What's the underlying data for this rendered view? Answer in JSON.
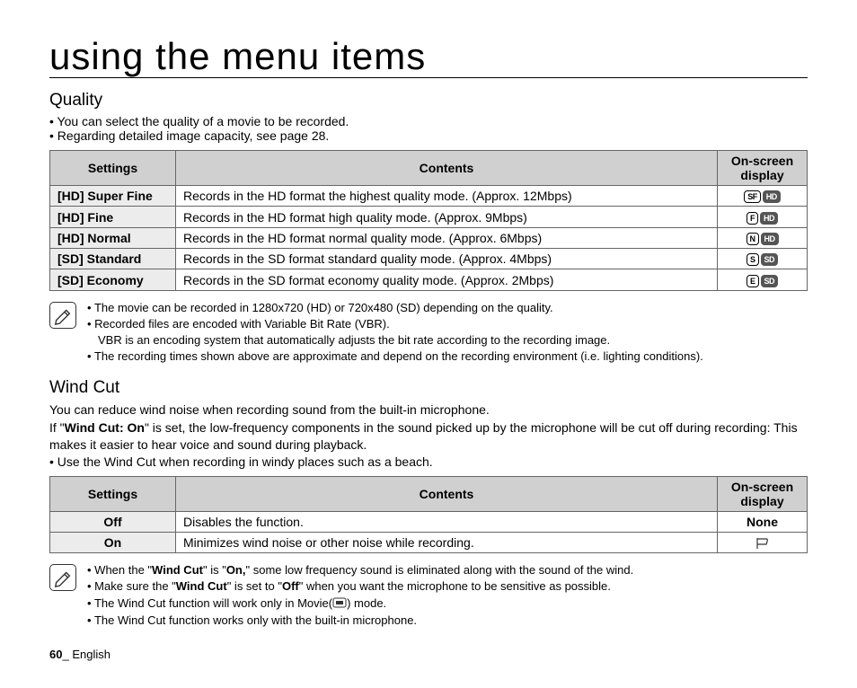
{
  "title": "using the menu items",
  "quality": {
    "heading": "Quality",
    "intro": [
      "You can select the quality of a movie to be recorded.",
      "Regarding detailed image capacity, see page 28."
    ],
    "headers": [
      "Settings",
      "Contents",
      "On-screen display"
    ],
    "rows": [
      {
        "setting": "[HD] Super Fine",
        "content": "Records in the HD format the highest quality mode. (Approx. 12Mbps)",
        "icon1": "SF",
        "icon2": "HD"
      },
      {
        "setting": "[HD] Fine",
        "content": "Records in the HD format high quality mode. (Approx. 9Mbps)",
        "icon1": "F",
        "icon2": "HD"
      },
      {
        "setting": "[HD] Normal",
        "content": "Records in the HD format normal quality mode. (Approx. 6Mbps)",
        "icon1": "N",
        "icon2": "HD"
      },
      {
        "setting": "[SD] Standard",
        "content": "Records in the SD format standard quality mode. (Approx. 4Mbps)",
        "icon1": "S",
        "icon2": "SD"
      },
      {
        "setting": "[SD] Economy",
        "content": "Records in the SD format economy quality mode. (Approx. 2Mbps)",
        "icon1": "E",
        "icon2": "SD"
      }
    ],
    "notes": {
      "n1": "The movie can be recorded in 1280x720 (HD) or 720x480 (SD) depending on the quality.",
      "n2": "Recorded files are encoded with Variable Bit Rate (VBR).",
      "n2b": "VBR is an encoding system that automatically adjusts the bit rate according to the recording image.",
      "n3": "The recording times shown above are approximate and depend on the recording environment (i.e. lighting conditions)."
    }
  },
  "windcut": {
    "heading": "Wind Cut",
    "p1": "You can reduce wind noise when recording sound from the built-in microphone.",
    "p2a": "If \"",
    "p2b": "Wind Cut: On",
    "p2c": "\" is set, the low-frequency components in the sound picked up by the microphone will be cut off during recording: This makes it easier to hear voice and sound during playback.",
    "bullet": "Use the Wind Cut when recording in windy places such as a beach.",
    "headers": [
      "Settings",
      "Contents",
      "On-screen display"
    ],
    "rows": [
      {
        "setting": "Off",
        "content": "Disables the function.",
        "display": "None"
      },
      {
        "setting": "On",
        "content": "Minimizes wind noise or other noise while recording.",
        "display": "flag"
      }
    ],
    "notes": {
      "n1a": "When the \"",
      "n1b": "Wind Cut",
      "n1c": "\" is \"",
      "n1d": "On,",
      "n1e": "\" some low frequency sound is eliminated along with the sound of the wind.",
      "n2a": "Make sure the \"",
      "n2b": "Wind Cut",
      "n2c": "\" is set to \"",
      "n2d": "Off",
      "n2e": "\" when you want the microphone to be sensitive as possible.",
      "n3a": "The Wind Cut function will work only in Movie(",
      "n3b": ") mode.",
      "n4": "The Wind Cut function works only with the built-in microphone."
    }
  },
  "footer": {
    "page": "60",
    "sep": "_ ",
    "lang": "English"
  }
}
